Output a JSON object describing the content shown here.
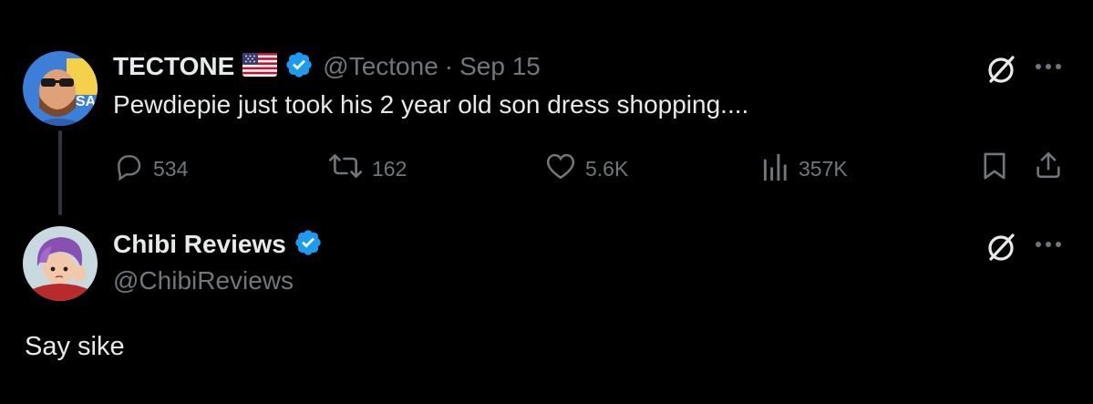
{
  "tweet": {
    "author": {
      "display_name": "TECTONE",
      "handle": "@Tectone",
      "flag": "us-flag-icon",
      "verified_icon": "verified-badge-icon"
    },
    "separator": "·",
    "date": "Sep 15",
    "text": "Pewdiepie just took his 2 year old son dress shopping....",
    "actions": {
      "replies": "534",
      "reposts": "162",
      "likes": "5.6K",
      "views": "357K"
    }
  },
  "reply": {
    "author": {
      "display_name": "Chibi Reviews",
      "handle": "@ChibiReviews",
      "verified_icon": "verified-badge-icon"
    },
    "text": "Say sike"
  },
  "colors": {
    "background": "#000000",
    "primary_text": "#e7e9ea",
    "secondary_text": "#71767b",
    "verified_blue": "#1d9bf0",
    "thread_line": "#333639"
  }
}
